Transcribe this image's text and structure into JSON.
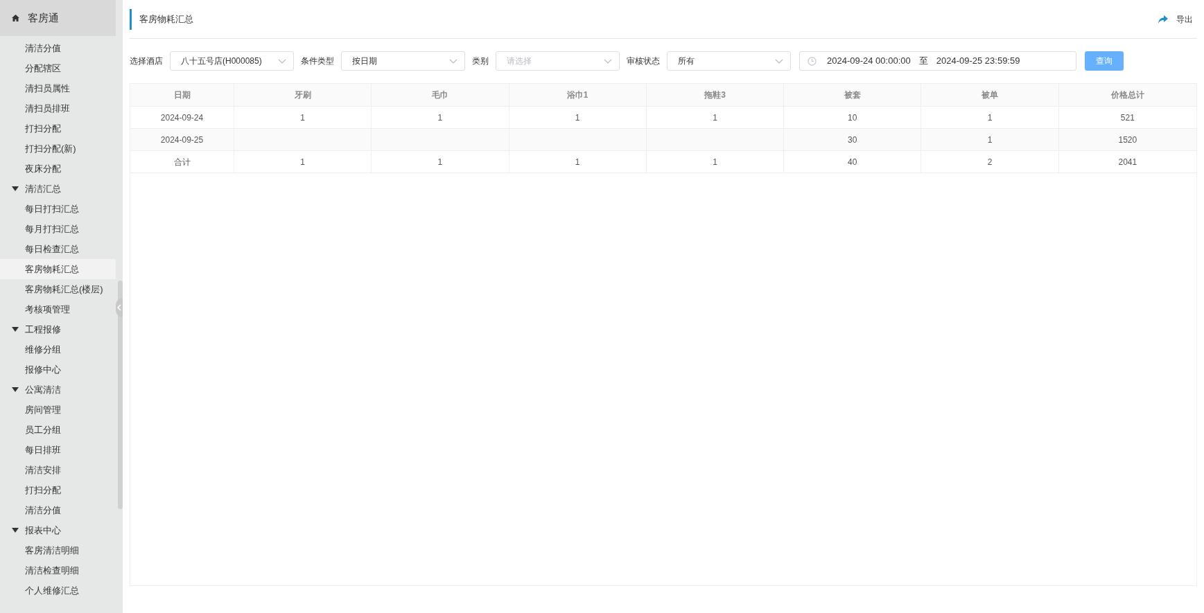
{
  "sidebar": {
    "title": "客房通",
    "items": [
      {
        "kind": "link",
        "label": "清洁分值",
        "selected": false
      },
      {
        "kind": "link",
        "label": "分配辖区",
        "selected": false
      },
      {
        "kind": "link",
        "label": "清扫员属性",
        "selected": false
      },
      {
        "kind": "link",
        "label": "清扫员排班",
        "selected": false
      },
      {
        "kind": "link",
        "label": "打扫分配",
        "selected": false
      },
      {
        "kind": "link",
        "label": "打扫分配(新)",
        "selected": false
      },
      {
        "kind": "link",
        "label": "夜床分配",
        "selected": false
      },
      {
        "kind": "group",
        "label": "清洁汇总",
        "expanded": true,
        "children": [
          {
            "kind": "link",
            "label": "每日打扫汇总",
            "selected": false
          },
          {
            "kind": "link",
            "label": "每月打扫汇总",
            "selected": false
          },
          {
            "kind": "link",
            "label": "每日检查汇总",
            "selected": false
          },
          {
            "kind": "link",
            "label": "客房物耗汇总",
            "selected": true
          },
          {
            "kind": "link",
            "label": "客房物耗汇总(楼层)",
            "selected": false
          },
          {
            "kind": "link",
            "label": "考核项管理",
            "selected": false
          }
        ]
      },
      {
        "kind": "group",
        "label": "工程报修",
        "expanded": true,
        "children": [
          {
            "kind": "link",
            "label": "维修分组",
            "selected": false
          },
          {
            "kind": "link",
            "label": "报修中心",
            "selected": false
          }
        ]
      },
      {
        "kind": "group",
        "label": "公寓清洁",
        "expanded": true,
        "children": [
          {
            "kind": "link",
            "label": "房间管理",
            "selected": false
          },
          {
            "kind": "link",
            "label": "员工分组",
            "selected": false
          },
          {
            "kind": "link",
            "label": "每日排班",
            "selected": false
          },
          {
            "kind": "link",
            "label": "清洁安排",
            "selected": false
          },
          {
            "kind": "link",
            "label": "打扫分配",
            "selected": false
          },
          {
            "kind": "link",
            "label": "清洁分值",
            "selected": false
          }
        ]
      },
      {
        "kind": "group",
        "label": "报表中心",
        "expanded": true,
        "children": [
          {
            "kind": "link",
            "label": "客房清洁明细",
            "selected": false
          },
          {
            "kind": "link",
            "label": "清洁检查明细",
            "selected": false
          },
          {
            "kind": "link",
            "label": "个人维修汇总",
            "selected": false
          }
        ]
      }
    ]
  },
  "page": {
    "title": "客房物耗汇总",
    "export": "导出"
  },
  "filters": [
    {
      "kind": "select",
      "label": "选择酒店",
      "value": "八十五号店(H000085)"
    },
    {
      "kind": "select",
      "label": "条件类型",
      "value": "按日期"
    },
    {
      "kind": "select",
      "label": "类别",
      "placeholder": "请选择"
    },
    {
      "kind": "select",
      "label": "审核状态",
      "value": "所有"
    },
    {
      "kind": "daterange",
      "start": "2024-09-24 00:00:00",
      "separator": "至",
      "end": "2024-09-25 23:59:59"
    }
  ],
  "query_button": "查询",
  "table": {
    "columns": [
      "日期",
      "牙刷",
      "毛巾",
      "浴巾1",
      "拖鞋3",
      "被套",
      "被单",
      "价格总计"
    ],
    "rows": [
      [
        "2024-09-24",
        "1",
        "1",
        "1",
        "1",
        "10",
        "1",
        "521"
      ],
      [
        "2024-09-25",
        "",
        "",
        "",
        "",
        "30",
        "1",
        "1520"
      ],
      [
        "合计",
        "1",
        "1",
        "1",
        "1",
        "40",
        "2",
        "2041"
      ]
    ]
  }
}
